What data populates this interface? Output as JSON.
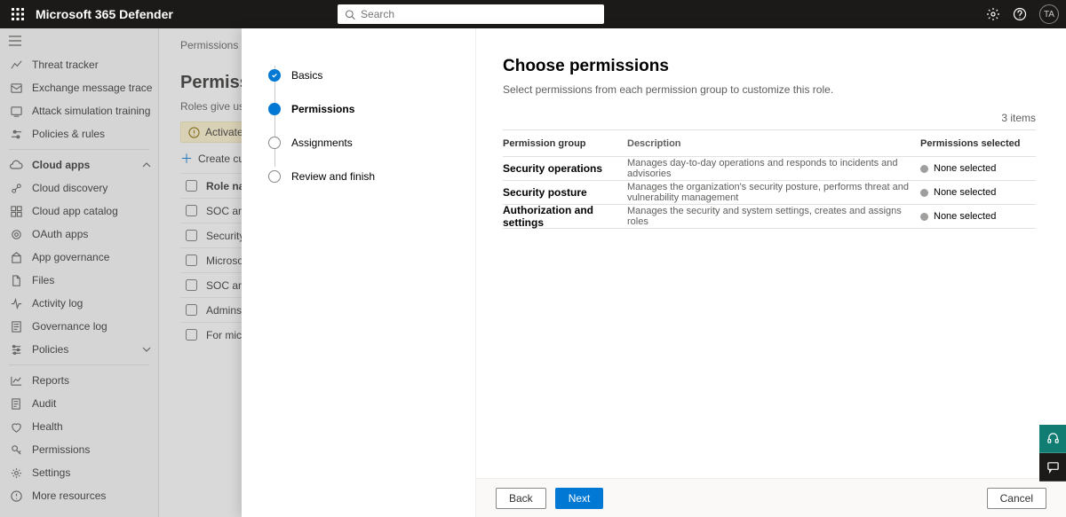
{
  "header": {
    "title": "Microsoft 365 Defender",
    "search_placeholder": "Search",
    "avatar": "TA"
  },
  "nav": {
    "items_top": [
      {
        "icon": "tracker",
        "label": "Threat tracker"
      },
      {
        "icon": "exchange",
        "label": "Exchange message trace"
      },
      {
        "icon": "attack",
        "label": "Attack simulation training"
      },
      {
        "icon": "policies",
        "label": "Policies & rules"
      }
    ],
    "section_cloud": {
      "label": "Cloud apps"
    },
    "items_cloud": [
      {
        "icon": "discovery",
        "label": "Cloud discovery"
      },
      {
        "icon": "catalog",
        "label": "Cloud app catalog"
      },
      {
        "icon": "oauth",
        "label": "OAuth apps"
      },
      {
        "icon": "appgov",
        "label": "App governance"
      },
      {
        "icon": "files",
        "label": "Files"
      },
      {
        "icon": "activity",
        "label": "Activity log"
      },
      {
        "icon": "govlog",
        "label": "Governance log"
      },
      {
        "icon": "policies2",
        "label": "Policies"
      }
    ],
    "items_bottom": [
      {
        "icon": "reports",
        "label": "Reports"
      },
      {
        "icon": "audit",
        "label": "Audit"
      },
      {
        "icon": "health",
        "label": "Health"
      },
      {
        "icon": "perm",
        "label": "Permissions"
      },
      {
        "icon": "settings",
        "label": "Settings"
      },
      {
        "icon": "more",
        "label": "More resources"
      }
    ]
  },
  "behind": {
    "crumb": "Permissions &",
    "heading": "Permissions",
    "sub": "Roles give use",
    "banner": "Activate wo",
    "create": "Create cust",
    "col_header": "Role nam",
    "rows": [
      "SOC ana",
      "Security",
      "Microso",
      "SOC ana",
      "Admins",
      "For mic"
    ]
  },
  "wizard": {
    "steps": [
      {
        "label": "Basics",
        "state": "done"
      },
      {
        "label": "Permissions",
        "state": "active"
      },
      {
        "label": "Assignments",
        "state": "pending"
      },
      {
        "label": "Review and finish",
        "state": "pending"
      }
    ],
    "heading": "Choose permissions",
    "sub": "Select permissions from each permission group to customize this role.",
    "count": "3 items",
    "columns": {
      "group": "Permission group",
      "desc": "Description",
      "sel": "Permissions selected"
    },
    "rows": [
      {
        "group": "Security operations",
        "desc": "Manages day-to-day operations and responds to incidents and advisories",
        "sel": "None selected"
      },
      {
        "group": "Security posture",
        "desc": "Manages the organization's security posture, performs threat and vulnerability management",
        "sel": "None selected"
      },
      {
        "group": "Authorization and settings",
        "desc": "Manages the security and system settings, creates and assigns roles",
        "sel": "None selected"
      }
    ],
    "buttons": {
      "back": "Back",
      "next": "Next",
      "cancel": "Cancel"
    }
  }
}
